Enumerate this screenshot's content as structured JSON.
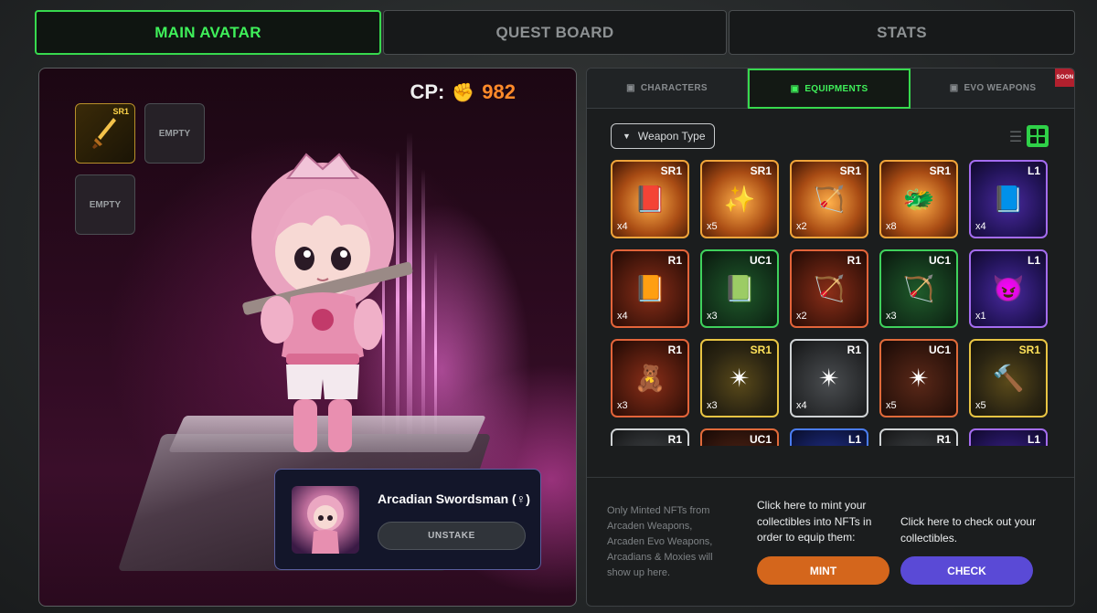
{
  "top_tabs": [
    {
      "label": "MAIN AVATAR",
      "active": true
    },
    {
      "label": "QUEST BOARD",
      "active": false
    },
    {
      "label": "STATS",
      "active": false
    }
  ],
  "avatar": {
    "cp_label": "CP:",
    "cp_icon": "fist-icon",
    "cp_value": "982",
    "slots": [
      {
        "state": "filled",
        "rarity": "SR1",
        "icon": "sword-icon"
      },
      {
        "state": "empty",
        "label": "EMPTY"
      },
      {
        "state": "empty",
        "label": "EMPTY"
      }
    ],
    "character_name": "Arcadian Swordsman (♀)",
    "unstake_label": "UNSTAKE"
  },
  "sub_tabs": [
    {
      "label": "CHARACTERS",
      "icon": "lock-icon",
      "active": false
    },
    {
      "label": "EQUIPMENTS",
      "icon": "lock-icon",
      "active": true
    },
    {
      "label": "EVO WEAPONS",
      "icon": "lock-icon",
      "active": false,
      "badge": "SOON"
    }
  ],
  "filter": {
    "label": "Weapon Type"
  },
  "view_modes": {
    "selected": "grid"
  },
  "items": [
    {
      "rarity": "SR1",
      "qty": "x4",
      "style": "SR1",
      "icon": "📕"
    },
    {
      "rarity": "SR1",
      "qty": "x5",
      "style": "SR1",
      "icon": "✨"
    },
    {
      "rarity": "SR1",
      "qty": "x2",
      "style": "SR1",
      "icon": "🏹"
    },
    {
      "rarity": "SR1",
      "qty": "x8",
      "style": "SR1",
      "icon": "🐲"
    },
    {
      "rarity": "L1",
      "qty": "x4",
      "style": "L1",
      "icon": "📘"
    },
    {
      "rarity": "R1",
      "qty": "x4",
      "style": "R1",
      "icon": "📙"
    },
    {
      "rarity": "UC1",
      "qty": "x3",
      "style": "UC1",
      "icon": "📗"
    },
    {
      "rarity": "R1",
      "qty": "x2",
      "style": "R1",
      "icon": "🏹"
    },
    {
      "rarity": "UC1",
      "qty": "x3",
      "style": "UC1",
      "icon": "🏹"
    },
    {
      "rarity": "L1",
      "qty": "x1",
      "style": "L1",
      "icon": "😈"
    },
    {
      "rarity": "R1",
      "qty": "x3",
      "style": "R1",
      "icon": "🧸"
    },
    {
      "rarity": "SR1",
      "qty": "x3",
      "style": "SR1y",
      "icon": "✴"
    },
    {
      "rarity": "R1",
      "qty": "x4",
      "style": "R1g",
      "icon": "✴"
    },
    {
      "rarity": "UC1",
      "qty": "x5",
      "style": "UC1o",
      "icon": "✴"
    },
    {
      "rarity": "SR1",
      "qty": "x5",
      "style": "SR1y",
      "icon": "🔨"
    },
    {
      "rarity": "R1",
      "qty": "",
      "style": "R1g",
      "icon": ""
    },
    {
      "rarity": "UC1",
      "qty": "",
      "style": "UC1o",
      "icon": ""
    },
    {
      "rarity": "L1",
      "qty": "",
      "style": "L1b",
      "icon": ""
    },
    {
      "rarity": "R1",
      "qty": "",
      "style": "R1g",
      "icon": ""
    },
    {
      "rarity": "L1",
      "qty": "",
      "style": "L1",
      "icon": ""
    }
  ],
  "footer": {
    "note": "Only Minted NFTs from Arcaden Weapons, Arcaden Evo Weapons, Arcadians & Moxies will show up here.",
    "mint_text": "Click here to mint your collectibles into NFTs in order to equip them:",
    "mint_label": "MINT",
    "check_text": "Click here to check out your collectibles.",
    "check_label": "CHECK"
  }
}
